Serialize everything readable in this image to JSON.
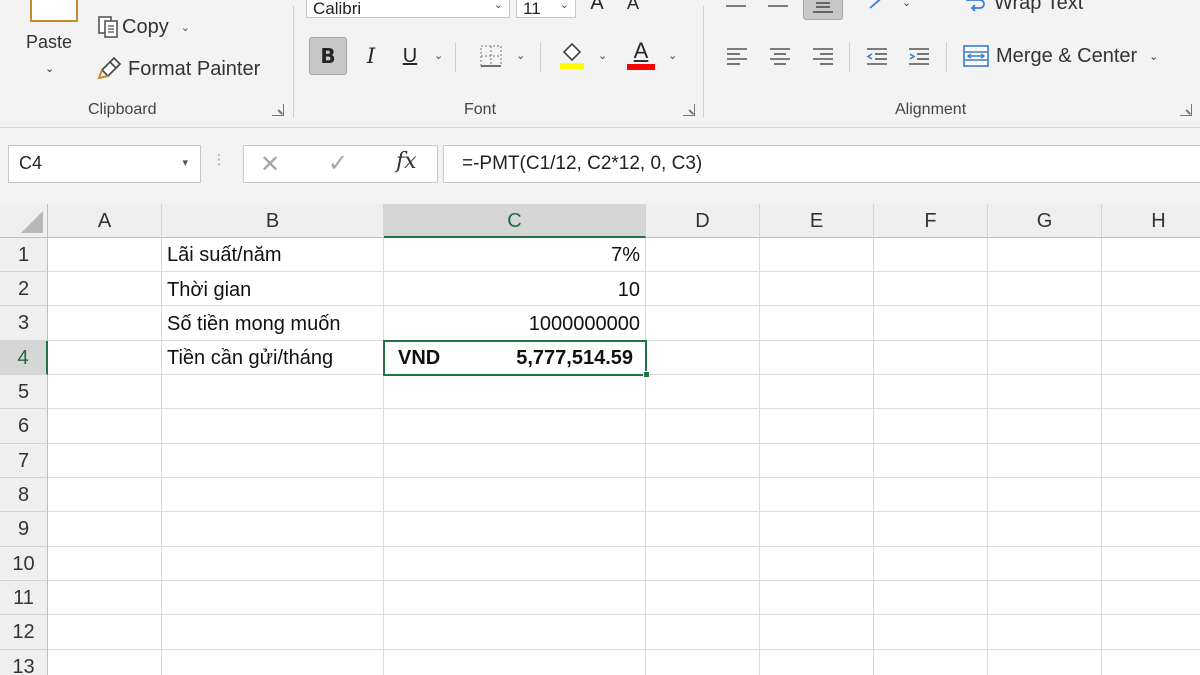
{
  "ribbon": {
    "clipboard": {
      "group_label": "Clipboard",
      "paste_label": "Paste",
      "copy_label": "Copy",
      "format_painter_label": "Format Painter"
    },
    "font": {
      "group_label": "Font",
      "font_name": "Calibri",
      "font_size": "11",
      "bold_label": "B",
      "italic_label": "I",
      "underline_label": "U",
      "font_color": "#ff0000",
      "fill_color": "#ffff00"
    },
    "alignment": {
      "group_label": "Alignment",
      "wrap_text_label": "Wrap Text",
      "merge_center_label": "Merge & Center"
    }
  },
  "formula_bar": {
    "name_box": "C4",
    "fx_label": "fx",
    "formula": "=-PMT(C1/12, C2*12, 0, C3)"
  },
  "grid": {
    "columns": [
      "A",
      "B",
      "C",
      "D",
      "E",
      "F",
      "G",
      "H"
    ],
    "rows": [
      "1",
      "2",
      "3",
      "4",
      "5",
      "6",
      "7",
      "8",
      "9",
      "10",
      "11",
      "12",
      "13"
    ],
    "active_column": "C",
    "active_row": "4",
    "cells": {
      "B1": "Lãi suất/năm",
      "C1": "7%",
      "B2": "Thời gian",
      "C2": "10",
      "B3": "Số tiền mong muốn",
      "C3": "1000000000",
      "B4": "Tiền cần gửi/tháng",
      "C4_currency": "VND",
      "C4_value": "5,777,514.59"
    },
    "accent_color": "#217346"
  }
}
